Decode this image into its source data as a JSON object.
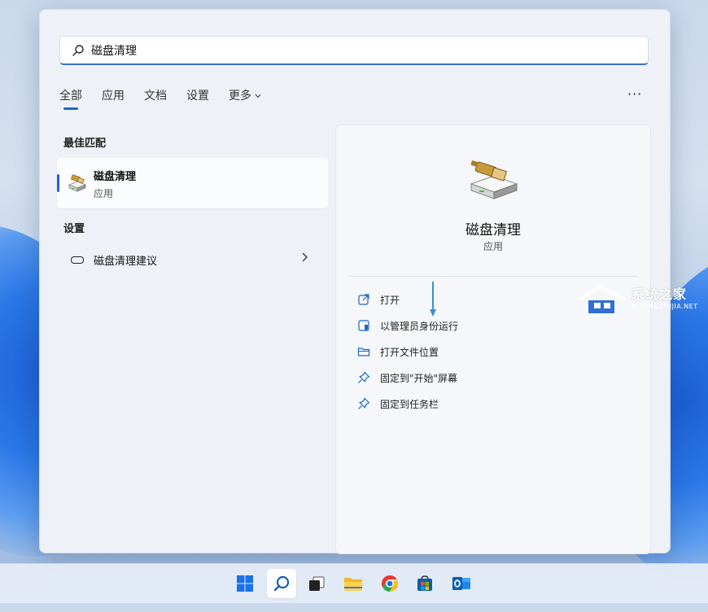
{
  "search": {
    "query": "磁盘清理"
  },
  "tabs": [
    {
      "label": "全部"
    },
    {
      "label": "应用"
    },
    {
      "label": "文档"
    },
    {
      "label": "设置"
    },
    {
      "label": "更多"
    }
  ],
  "more_menu_label": "···",
  "best_match": {
    "section_title": "最佳匹配",
    "name": "磁盘清理",
    "type": "应用"
  },
  "settings": {
    "section_title": "设置",
    "item_label": "磁盘清理建议"
  },
  "details": {
    "title": "磁盘清理",
    "subtitle": "应用",
    "actions": [
      {
        "label": "打开",
        "icon": "open-icon"
      },
      {
        "label": "以管理员身份运行",
        "icon": "shield-admin-icon"
      },
      {
        "label": "打开文件位置",
        "icon": "folder-icon"
      },
      {
        "label": "固定到\"开始\"屏幕",
        "icon": "pin-icon"
      },
      {
        "label": "固定到任务栏",
        "icon": "pin-icon"
      }
    ]
  },
  "watermark": {
    "title": "系统之家",
    "subtitle": "XITONGZHIJIA.NET"
  },
  "taskbar": {
    "icons": [
      "windows-start-icon",
      "search-icon",
      "task-view-icon",
      "file-explorer-icon",
      "chrome-icon",
      "store-icon",
      "outlook-icon"
    ]
  },
  "colors": {
    "accent": "#1e66c8",
    "wallpaper_blue": "#1d5fd6"
  }
}
